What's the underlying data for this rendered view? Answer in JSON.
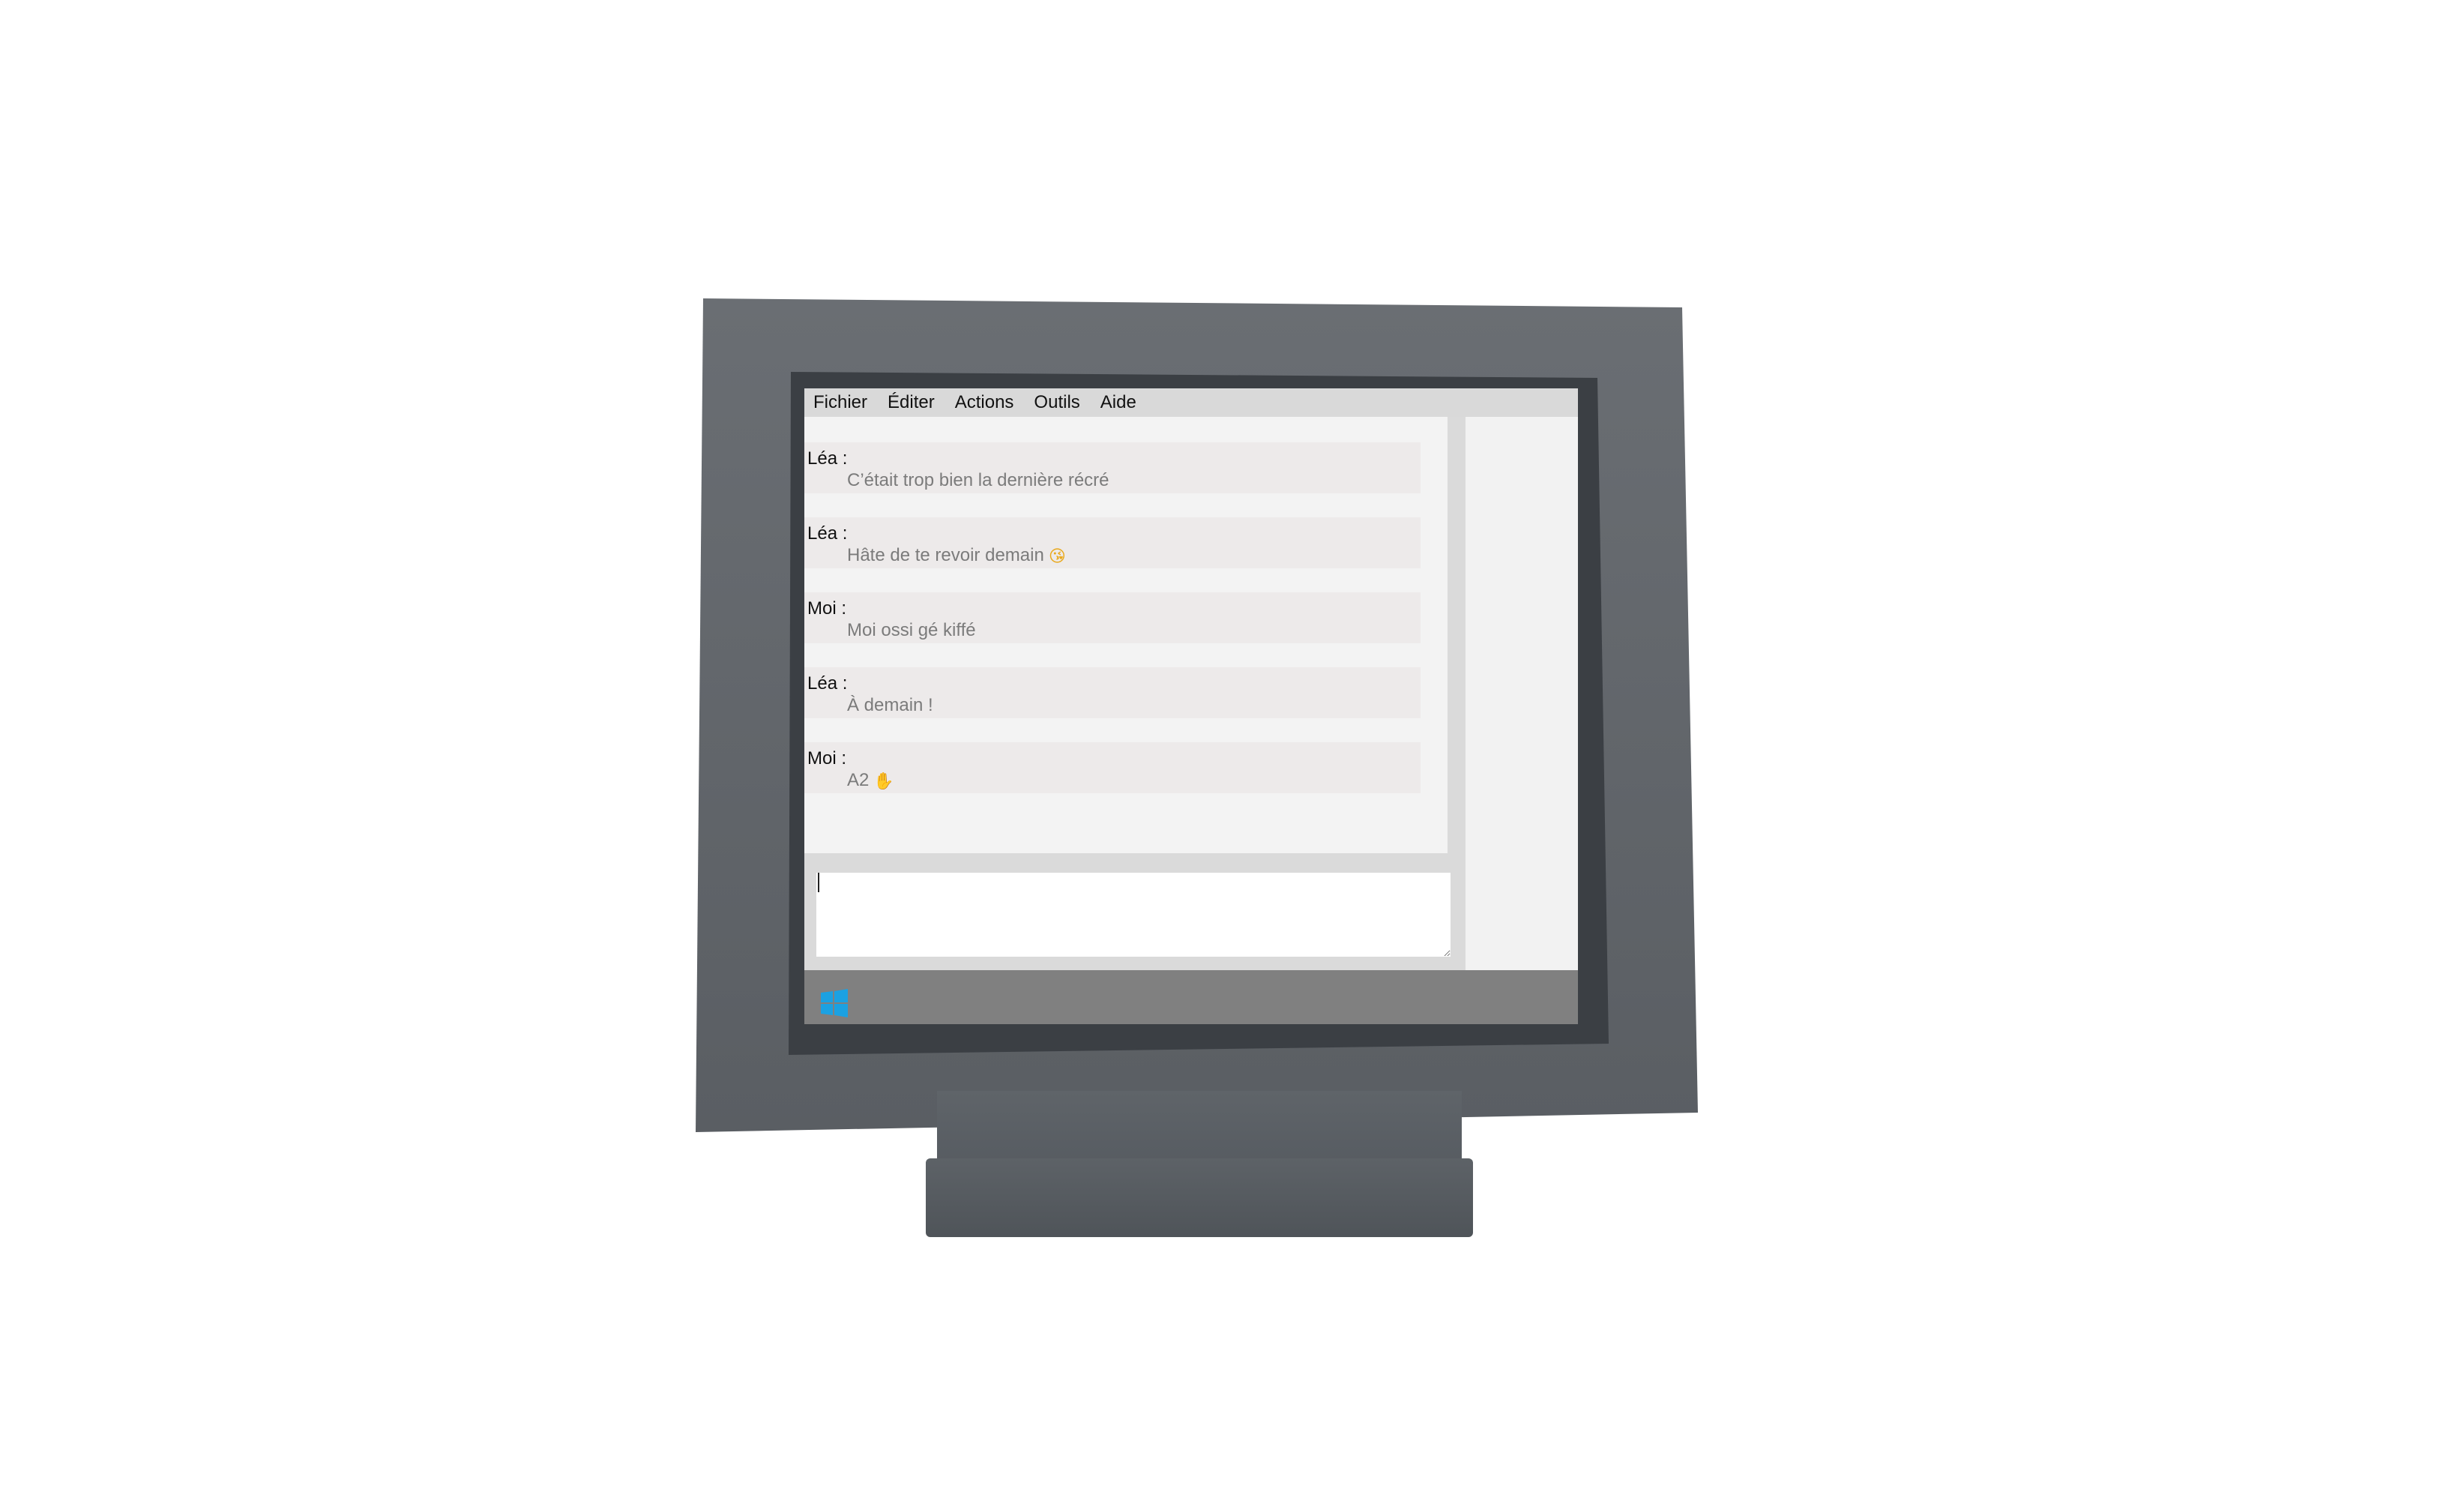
{
  "menu": {
    "items": [
      "Fichier",
      "Éditer",
      "Actions",
      "Outils",
      "Aide"
    ]
  },
  "messages": [
    {
      "author": "Léa :",
      "text": "C’était trop bien la dernière récré",
      "emoji": ""
    },
    {
      "author": "Léa :",
      "text": "Hâte de te revoir demain",
      "emoji": "😘"
    },
    {
      "author": "Moi :",
      "text": "Moi ossi gé kiffé",
      "emoji": ""
    },
    {
      "author": "Léa :",
      "text": "À demain !",
      "emoji": ""
    },
    {
      "author": "Moi :",
      "text": "A2",
      "emoji": "✋"
    }
  ],
  "input": {
    "value": ""
  },
  "colors": {
    "bezel": "#5f6469",
    "menubar": "#d9d9d9",
    "message_bg": "#edeaea",
    "message_text": "#7b7b7b",
    "taskbar": "#808080",
    "start_icon": "#1ba1e2"
  },
  "icons": {
    "start": "windows-logo-icon"
  }
}
